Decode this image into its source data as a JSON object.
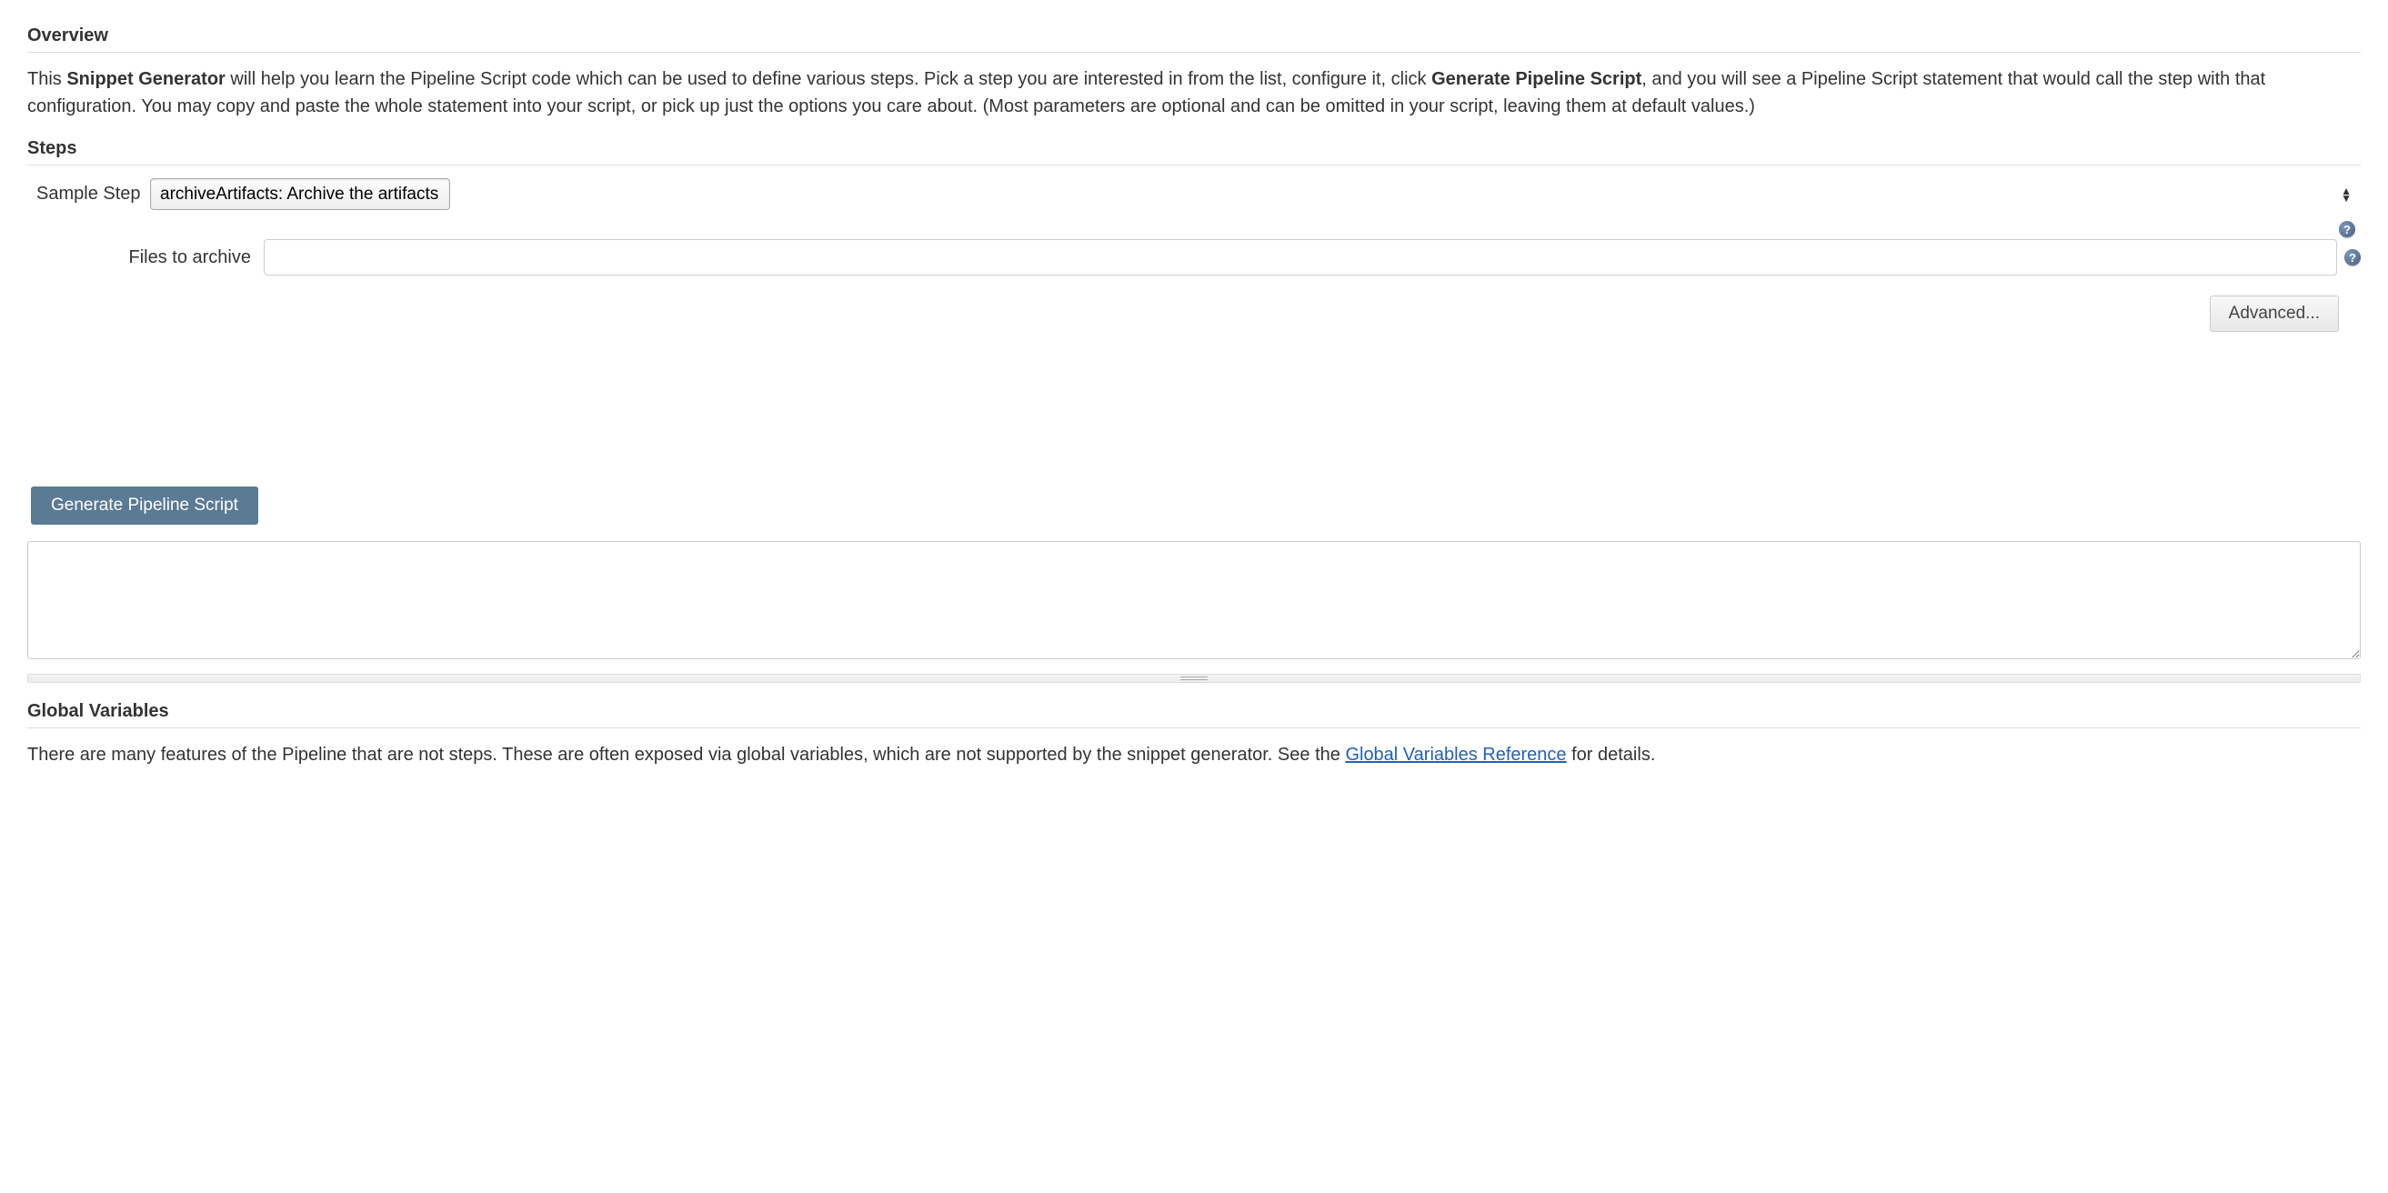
{
  "overview": {
    "heading": "Overview",
    "text_part1": "This ",
    "bold1": "Snippet Generator",
    "text_part2": " will help you learn the Pipeline Script code which can be used to define various steps. Pick a step you are interested in from the list, configure it, click ",
    "bold2": "Generate Pipeline Script",
    "text_part3": ", and you will see a Pipeline Script statement that would call the step with that configuration. You may copy and paste the whole statement into your script, or pick up just the options you care about. (Most parameters are optional and can be omitted in your script, leaving them at default values.)"
  },
  "steps": {
    "heading": "Steps",
    "sample_step_label": "Sample Step",
    "selected_step": "archiveArtifacts: Archive the artifacts",
    "files_to_archive_label": "Files to archive",
    "files_to_archive_value": "",
    "advanced_button": "Advanced...",
    "help_icon_text": "?"
  },
  "generate": {
    "button_label": "Generate Pipeline Script",
    "output_value": ""
  },
  "global_variables": {
    "heading": "Global Variables",
    "text_part1": "There are many features of the Pipeline that are not steps. These are often exposed via global variables, which are not supported by the snippet generator. See the ",
    "link_text": "Global Variables Reference",
    "text_part2": " for details."
  }
}
